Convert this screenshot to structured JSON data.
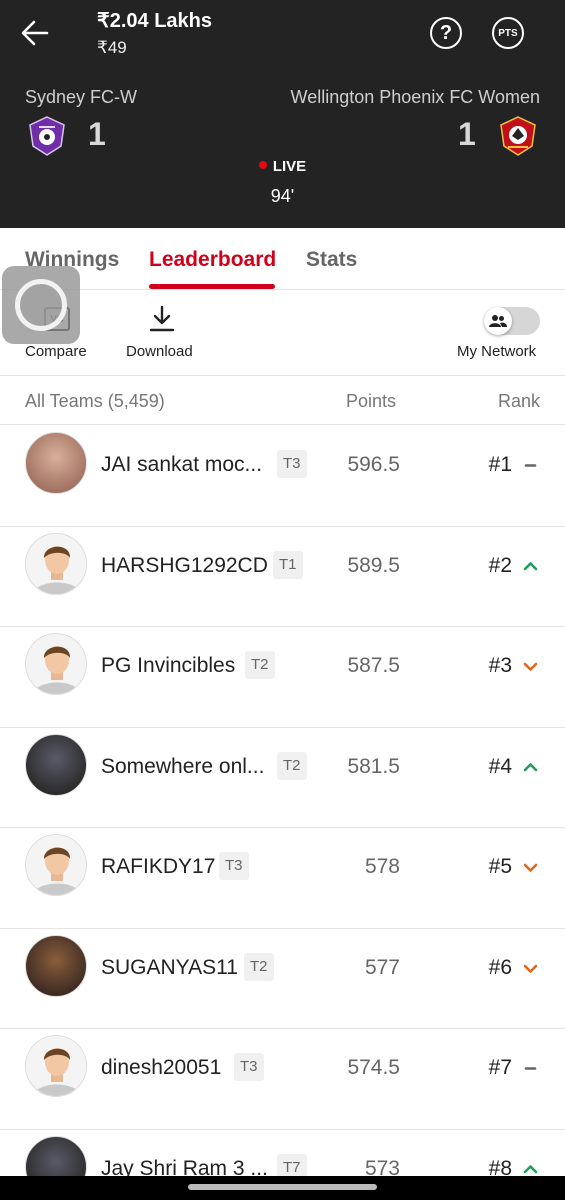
{
  "header": {
    "prize": "₹2.04 Lakhs",
    "entry_fee": "₹49",
    "pts_label": "PTS",
    "help_label": "?"
  },
  "match": {
    "home_team": "Sydney FC-W",
    "away_team": "Wellington Phoenix FC Women",
    "home_score": "1",
    "away_score": "1",
    "status": "LIVE",
    "minute": "94'"
  },
  "tabs": [
    {
      "label": "Winnings",
      "active": false
    },
    {
      "label": "Leaderboard",
      "active": true
    },
    {
      "label": "Stats",
      "active": false
    }
  ],
  "actions": {
    "compare": "Compare",
    "compare_icon_text": "VS",
    "download": "Download",
    "my_network": "My Network"
  },
  "columns": {
    "teams": "All Teams (5,459)",
    "points": "Points",
    "rank": "Rank"
  },
  "rows": [
    {
      "name": "JAI sankat moc...",
      "team": "T3",
      "points": "596.5",
      "rank": "#1",
      "trend": "same",
      "avatar": "photo"
    },
    {
      "name": "HARSHG1292CD",
      "team": "T1",
      "points": "589.5",
      "rank": "#2",
      "trend": "up",
      "avatar": "default"
    },
    {
      "name": "PG Invincibles",
      "team": "T2",
      "points": "587.5",
      "rank": "#3",
      "trend": "down",
      "avatar": "default"
    },
    {
      "name": "Somewhere onl...",
      "team": "T2",
      "points": "581.5",
      "rank": "#4",
      "trend": "up",
      "avatar": "photo"
    },
    {
      "name": "RAFIKDY17",
      "team": "T3",
      "points": "578",
      "rank": "#5",
      "trend": "down",
      "avatar": "default"
    },
    {
      "name": "SUGANYAS11",
      "team": "T2",
      "points": "577",
      "rank": "#6",
      "trend": "down",
      "avatar": "photo"
    },
    {
      "name": "dinesh20051",
      "team": "T3",
      "points": "574.5",
      "rank": "#7",
      "trend": "same",
      "avatar": "default"
    },
    {
      "name": "Jay Shri Ram 3 ...",
      "team": "T7",
      "points": "573",
      "rank": "#8",
      "trend": "up",
      "avatar": "photo"
    }
  ],
  "colors": {
    "header_bg": "#232323",
    "accent": "#d0021b",
    "trend_up": "#1e9e5a",
    "trend_down": "#e0661b",
    "trend_same": "#666666"
  },
  "icons": {
    "back": "arrow-left-icon",
    "help": "question-circle-icon",
    "pts": "points-circle-icon",
    "compare": "vs-compare-icon",
    "download": "download-icon",
    "network": "people-icon",
    "trend_up": "chevron-up-icon",
    "trend_down": "chevron-down-icon",
    "trend_same": "dash-icon"
  }
}
